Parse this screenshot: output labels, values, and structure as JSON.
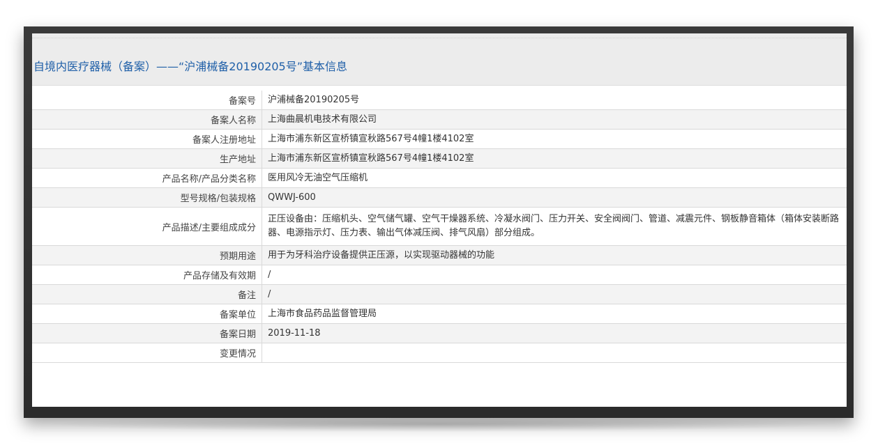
{
  "header": {
    "title": "自境内医疗器械（备案）——“沪浦械备20190205号”基本信息"
  },
  "rows": [
    {
      "label": "备案号",
      "value": "沪浦械备20190205号"
    },
    {
      "label": "备案人名称",
      "value": "上海曲晨机电技术有限公司"
    },
    {
      "label": "备案人注册地址",
      "value": "上海市浦东新区宣桥镇宣秋路567号4幢1楼4102室"
    },
    {
      "label": "生产地址",
      "value": "上海市浦东新区宣桥镇宣秋路567号4幢1楼4102室"
    },
    {
      "label": "产品名称/产品分类名称",
      "value": "医用风冷无油空气压缩机"
    },
    {
      "label": "型号规格/包装规格",
      "value": "QWWJ-600"
    },
    {
      "label": "产品描述/主要组成成分",
      "value": "正压设备由：压缩机头、空气储气罐、空气干燥器系统、冷凝水阀门、压力开关、安全阀阀门、管道、减震元件、钢板静音箱体（箱体安装断路器、电源指示灯、压力表、输出气体减压阀、排气风扇）部分组成。"
    },
    {
      "label": "预期用途",
      "value": "用于为牙科治疗设备提供正压源，以实现驱动器械的功能"
    },
    {
      "label": "产品存储及有效期",
      "value": "/"
    },
    {
      "label": "备注",
      "value": "/"
    },
    {
      "label": "备案单位",
      "value": "上海市食品药品监督管理局"
    },
    {
      "label": "备案日期",
      "value": "2019-11-18"
    },
    {
      "label": "变更情况",
      "value": ""
    }
  ]
}
